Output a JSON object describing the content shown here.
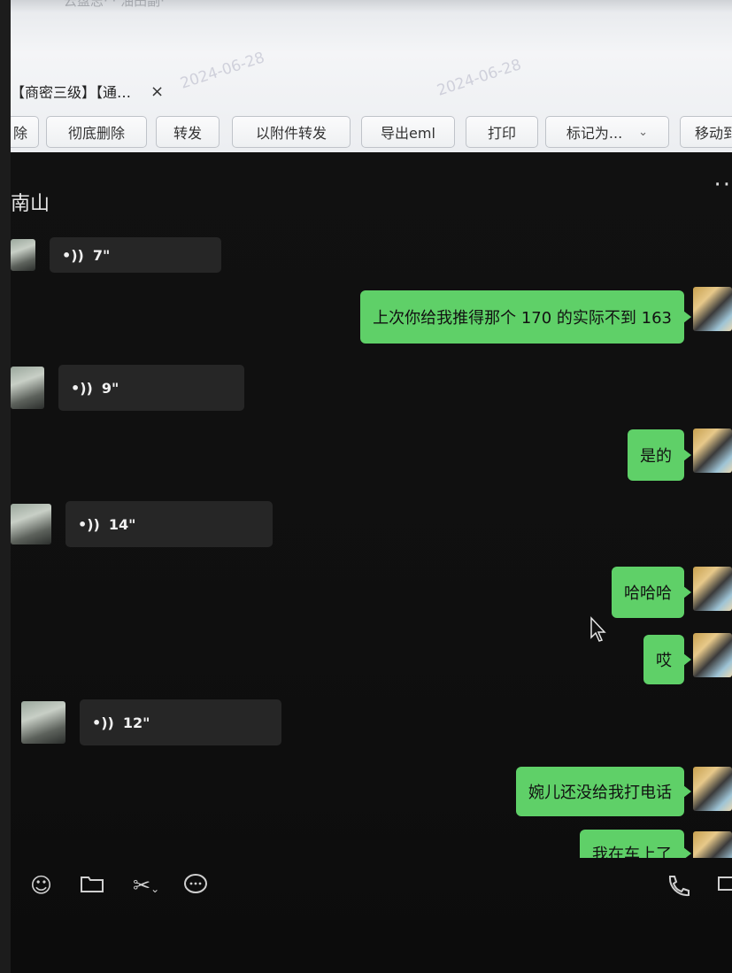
{
  "mail": {
    "ghost_text": "云盘志· · 油田副·",
    "tab_title": "【商密三级】【通…",
    "tab_close": "×",
    "watermarks": [
      "2024-06-28",
      "2024-06-28"
    ],
    "toolbar": [
      {
        "label": "除"
      },
      {
        "label": "彻底删除"
      },
      {
        "label": "转发"
      },
      {
        "label": "以附件转发"
      },
      {
        "label": "导出eml"
      },
      {
        "label": "打印"
      },
      {
        "label": "标记为..."
      },
      {
        "label": "移动到"
      }
    ],
    "chevron": "⌄"
  },
  "chat": {
    "title": "南山",
    "more": "··",
    "voice_icon": "•))",
    "incoming": [
      {
        "duration": "7\""
      },
      {
        "duration": "9\""
      },
      {
        "duration": "14\""
      },
      {
        "duration": "12\""
      }
    ],
    "outgoing": [
      {
        "text": "上次你给我推得那个 170 的实际不到 163"
      },
      {
        "text": "是的"
      },
      {
        "text": "哈哈哈"
      },
      {
        "text": "哎"
      },
      {
        "text": "婉儿还没给我打电话"
      },
      {
        "text": "我在车上了"
      }
    ],
    "bottom_icons": [
      "emoji-icon",
      "folder-icon",
      "scissors-icon",
      "chat-bubble-icon",
      "phone-icon",
      "video-icon"
    ]
  }
}
